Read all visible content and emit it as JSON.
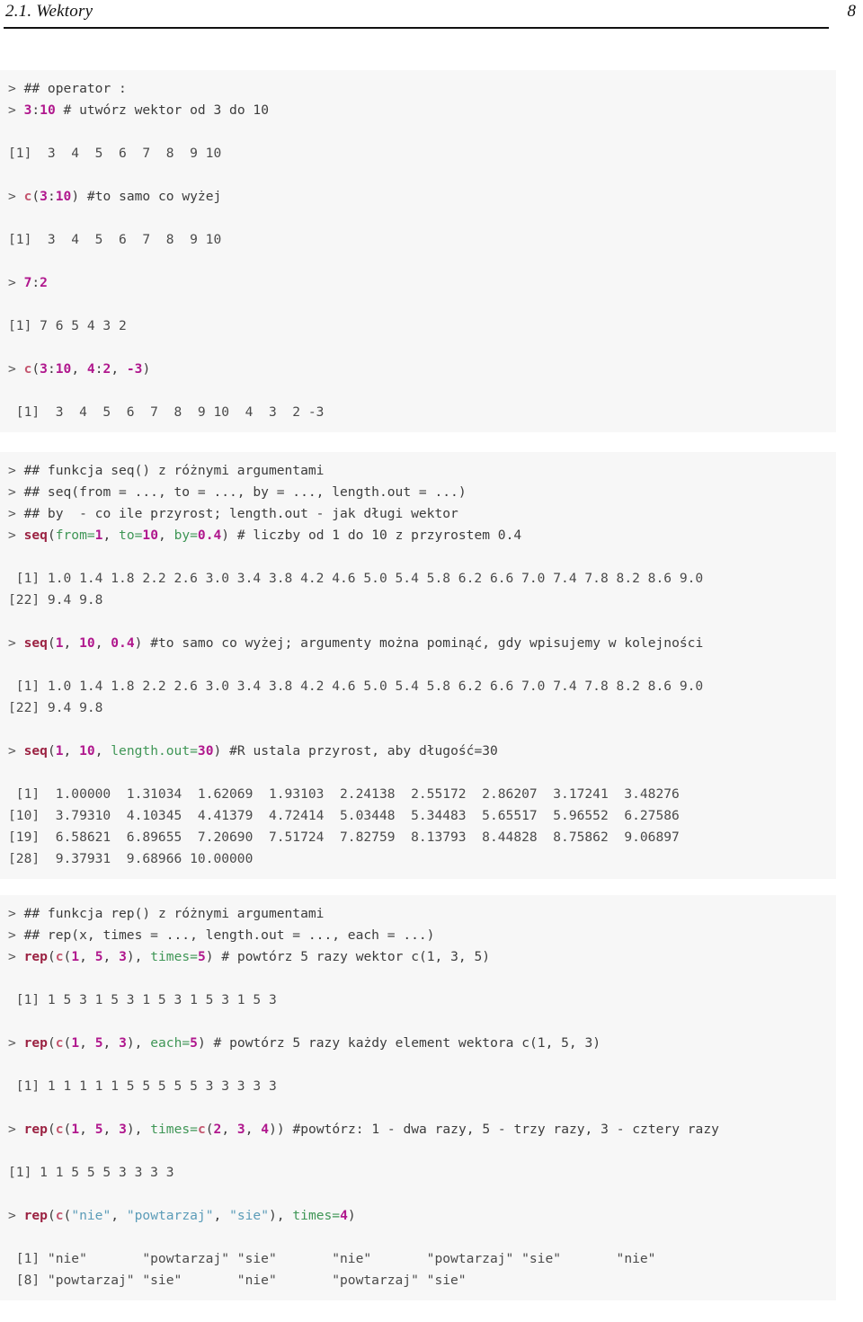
{
  "header": {
    "section_title": "2.1. Wektory",
    "page_number": "8"
  },
  "colors": {
    "page_background": "#ffffff",
    "code_background": "#f7f7f7",
    "code_text": "#3c3c3c",
    "number_token": "#b0178d",
    "function_token": "#9b2242",
    "function_c_token": "#c4566f",
    "argument_token": "#3f9656",
    "string_token": "#5b9cb8",
    "comment_token": "#b9b2bd",
    "output_text": "#4a4a4a",
    "rule_color": "#111111"
  },
  "blocks": [
    {
      "id": "block-operator-colon",
      "lines": [
        {
          "id": "l1",
          "kind": "input",
          "prompt": "> ",
          "segments": [
            {
              "t": "comment",
              "v": "## operator :"
            }
          ]
        },
        {
          "id": "l2",
          "kind": "input",
          "prompt": "> ",
          "segments": [
            {
              "t": "num",
              "v": "3"
            },
            {
              "t": "op",
              "v": ":"
            },
            {
              "t": "num",
              "v": "10"
            },
            {
              "t": "comment",
              "v": " # utwórz wektor od 3 do 10"
            }
          ]
        },
        {
          "id": "l3",
          "kind": "blank",
          "text": " "
        },
        {
          "id": "l4",
          "kind": "output",
          "text": "[1]  3  4  5  6  7  8  9 10"
        },
        {
          "id": "l5",
          "kind": "blank",
          "text": " "
        },
        {
          "id": "l6",
          "kind": "input",
          "prompt": "> ",
          "segments": [
            {
              "t": "fnc",
              "v": "c"
            },
            {
              "t": "op",
              "v": "("
            },
            {
              "t": "num",
              "v": "3"
            },
            {
              "t": "op",
              "v": ":"
            },
            {
              "t": "num",
              "v": "10"
            },
            {
              "t": "op",
              "v": ")"
            },
            {
              "t": "comment",
              "v": " #to samo co wyżej"
            }
          ]
        },
        {
          "id": "l7",
          "kind": "blank",
          "text": " "
        },
        {
          "id": "l8",
          "kind": "output",
          "text": "[1]  3  4  5  6  7  8  9 10"
        },
        {
          "id": "l9",
          "kind": "blank",
          "text": " "
        },
        {
          "id": "l10",
          "kind": "input",
          "prompt": "> ",
          "segments": [
            {
              "t": "num",
              "v": "7"
            },
            {
              "t": "op",
              "v": ":"
            },
            {
              "t": "num",
              "v": "2"
            }
          ]
        },
        {
          "id": "l11",
          "kind": "blank",
          "text": " "
        },
        {
          "id": "l12",
          "kind": "output",
          "text": "[1] 7 6 5 4 3 2"
        },
        {
          "id": "l13",
          "kind": "blank",
          "text": " "
        },
        {
          "id": "l14",
          "kind": "input",
          "prompt": "> ",
          "segments": [
            {
              "t": "fnc",
              "v": "c"
            },
            {
              "t": "op",
              "v": "("
            },
            {
              "t": "num",
              "v": "3"
            },
            {
              "t": "op",
              "v": ":"
            },
            {
              "t": "num",
              "v": "10"
            },
            {
              "t": "op",
              "v": ", "
            },
            {
              "t": "num",
              "v": "4"
            },
            {
              "t": "op",
              "v": ":"
            },
            {
              "t": "num",
              "v": "2"
            },
            {
              "t": "op",
              "v": ", "
            },
            {
              "t": "num",
              "v": "-3"
            },
            {
              "t": "op",
              "v": ")"
            }
          ]
        },
        {
          "id": "l15",
          "kind": "blank",
          "text": " "
        },
        {
          "id": "l16",
          "kind": "output",
          "text": " [1]  3  4  5  6  7  8  9 10  4  3  2 -3"
        }
      ]
    },
    {
      "id": "block-seq",
      "lines": [
        {
          "id": "s1",
          "kind": "input",
          "prompt": "> ",
          "segments": [
            {
              "t": "comment",
              "v": "## funkcja seq() z różnymi argumentami"
            }
          ]
        },
        {
          "id": "s2",
          "kind": "input",
          "prompt": "> ",
          "segments": [
            {
              "t": "comment",
              "v": "## seq(from = ..., to = ..., by = ..., length.out = ...)"
            }
          ]
        },
        {
          "id": "s3",
          "kind": "input",
          "prompt": "> ",
          "segments": [
            {
              "t": "comment",
              "v": "## by  - co ile przyrost; length.out - jak długi wektor"
            }
          ]
        },
        {
          "id": "s4",
          "kind": "input",
          "prompt": "> ",
          "segments": [
            {
              "t": "fn",
              "v": "seq"
            },
            {
              "t": "op",
              "v": "("
            },
            {
              "t": "arg",
              "v": "from="
            },
            {
              "t": "num",
              "v": "1"
            },
            {
              "t": "op",
              "v": ", "
            },
            {
              "t": "arg",
              "v": "to="
            },
            {
              "t": "num",
              "v": "10"
            },
            {
              "t": "op",
              "v": ", "
            },
            {
              "t": "arg",
              "v": "by="
            },
            {
              "t": "num",
              "v": "0.4"
            },
            {
              "t": "op",
              "v": ")"
            },
            {
              "t": "comment",
              "v": " # liczby od 1 do 10 z przyrostem 0.4"
            }
          ]
        },
        {
          "id": "s5",
          "kind": "blank",
          "text": " "
        },
        {
          "id": "s6",
          "kind": "output",
          "text": " [1] 1.0 1.4 1.8 2.2 2.6 3.0 3.4 3.8 4.2 4.6 5.0 5.4 5.8 6.2 6.6 7.0 7.4 7.8 8.2 8.6 9.0"
        },
        {
          "id": "s7",
          "kind": "output",
          "text": "[22] 9.4 9.8"
        },
        {
          "id": "s8",
          "kind": "blank",
          "text": " "
        },
        {
          "id": "s9",
          "kind": "input",
          "prompt": "> ",
          "segments": [
            {
              "t": "fn",
              "v": "seq"
            },
            {
              "t": "op",
              "v": "("
            },
            {
              "t": "num",
              "v": "1"
            },
            {
              "t": "op",
              "v": ", "
            },
            {
              "t": "num",
              "v": "10"
            },
            {
              "t": "op",
              "v": ", "
            },
            {
              "t": "num",
              "v": "0.4"
            },
            {
              "t": "op",
              "v": ")"
            },
            {
              "t": "comment",
              "v": " #to samo co wyżej; argumenty można pominąć, gdy wpisujemy w kolejności"
            }
          ]
        },
        {
          "id": "s10",
          "kind": "blank",
          "text": " "
        },
        {
          "id": "s11",
          "kind": "output",
          "text": " [1] 1.0 1.4 1.8 2.2 2.6 3.0 3.4 3.8 4.2 4.6 5.0 5.4 5.8 6.2 6.6 7.0 7.4 7.8 8.2 8.6 9.0"
        },
        {
          "id": "s12",
          "kind": "output",
          "text": "[22] 9.4 9.8"
        },
        {
          "id": "s13",
          "kind": "blank",
          "text": " "
        },
        {
          "id": "s14",
          "kind": "input",
          "prompt": "> ",
          "segments": [
            {
              "t": "fn",
              "v": "seq"
            },
            {
              "t": "op",
              "v": "("
            },
            {
              "t": "num",
              "v": "1"
            },
            {
              "t": "op",
              "v": ", "
            },
            {
              "t": "num",
              "v": "10"
            },
            {
              "t": "op",
              "v": ", "
            },
            {
              "t": "arg",
              "v": "length.out="
            },
            {
              "t": "num",
              "v": "30"
            },
            {
              "t": "op",
              "v": ")"
            },
            {
              "t": "comment",
              "v": " #R ustala przyrost, aby długość=30"
            }
          ]
        },
        {
          "id": "s15",
          "kind": "blank",
          "text": " "
        },
        {
          "id": "s16",
          "kind": "output",
          "text": " [1]  1.00000  1.31034  1.62069  1.93103  2.24138  2.55172  2.86207  3.17241  3.48276"
        },
        {
          "id": "s17",
          "kind": "output",
          "text": "[10]  3.79310  4.10345  4.41379  4.72414  5.03448  5.34483  5.65517  5.96552  6.27586"
        },
        {
          "id": "s18",
          "kind": "output",
          "text": "[19]  6.58621  6.89655  7.20690  7.51724  7.82759  8.13793  8.44828  8.75862  9.06897"
        },
        {
          "id": "s19",
          "kind": "output",
          "text": "[28]  9.37931  9.68966 10.00000"
        }
      ]
    },
    {
      "id": "block-rep",
      "lines": [
        {
          "id": "r1",
          "kind": "input",
          "prompt": "> ",
          "segments": [
            {
              "t": "comment",
              "v": "## funkcja rep() z różnymi argumentami"
            }
          ]
        },
        {
          "id": "r2",
          "kind": "input",
          "prompt": "> ",
          "segments": [
            {
              "t": "comment",
              "v": "## rep(x, times = ..., length.out = ..., each = ...)"
            }
          ]
        },
        {
          "id": "r3",
          "kind": "input",
          "prompt": "> ",
          "segments": [
            {
              "t": "fn",
              "v": "rep"
            },
            {
              "t": "op",
              "v": "("
            },
            {
              "t": "fnc",
              "v": "c"
            },
            {
              "t": "op",
              "v": "("
            },
            {
              "t": "num",
              "v": "1"
            },
            {
              "t": "op",
              "v": ", "
            },
            {
              "t": "num",
              "v": "5"
            },
            {
              "t": "op",
              "v": ", "
            },
            {
              "t": "num",
              "v": "3"
            },
            {
              "t": "op",
              "v": "), "
            },
            {
              "t": "arg",
              "v": "times="
            },
            {
              "t": "num",
              "v": "5"
            },
            {
              "t": "op",
              "v": ")"
            },
            {
              "t": "comment",
              "v": " # powtórz 5 razy wektor c(1, 3, 5)"
            }
          ]
        },
        {
          "id": "r4",
          "kind": "blank",
          "text": " "
        },
        {
          "id": "r5",
          "kind": "output",
          "text": " [1] 1 5 3 1 5 3 1 5 3 1 5 3 1 5 3"
        },
        {
          "id": "r6",
          "kind": "blank",
          "text": " "
        },
        {
          "id": "r7",
          "kind": "input",
          "prompt": "> ",
          "segments": [
            {
              "t": "fn",
              "v": "rep"
            },
            {
              "t": "op",
              "v": "("
            },
            {
              "t": "fnc",
              "v": "c"
            },
            {
              "t": "op",
              "v": "("
            },
            {
              "t": "num",
              "v": "1"
            },
            {
              "t": "op",
              "v": ", "
            },
            {
              "t": "num",
              "v": "5"
            },
            {
              "t": "op",
              "v": ", "
            },
            {
              "t": "num",
              "v": "3"
            },
            {
              "t": "op",
              "v": "), "
            },
            {
              "t": "arg",
              "v": "each="
            },
            {
              "t": "num",
              "v": "5"
            },
            {
              "t": "op",
              "v": ")"
            },
            {
              "t": "comment",
              "v": " # powtórz 5 razy każdy element wektora c(1, 5, 3)"
            }
          ]
        },
        {
          "id": "r8",
          "kind": "blank",
          "text": " "
        },
        {
          "id": "r9",
          "kind": "output",
          "text": " [1] 1 1 1 1 1 5 5 5 5 5 3 3 3 3 3"
        },
        {
          "id": "r10",
          "kind": "blank",
          "text": " "
        },
        {
          "id": "r11",
          "kind": "input",
          "prompt": "> ",
          "segments": [
            {
              "t": "fn",
              "v": "rep"
            },
            {
              "t": "op",
              "v": "("
            },
            {
              "t": "fnc",
              "v": "c"
            },
            {
              "t": "op",
              "v": "("
            },
            {
              "t": "num",
              "v": "1"
            },
            {
              "t": "op",
              "v": ", "
            },
            {
              "t": "num",
              "v": "5"
            },
            {
              "t": "op",
              "v": ", "
            },
            {
              "t": "num",
              "v": "3"
            },
            {
              "t": "op",
              "v": "), "
            },
            {
              "t": "arg",
              "v": "times="
            },
            {
              "t": "fnc",
              "v": "c"
            },
            {
              "t": "op",
              "v": "("
            },
            {
              "t": "num",
              "v": "2"
            },
            {
              "t": "op",
              "v": ", "
            },
            {
              "t": "num",
              "v": "3"
            },
            {
              "t": "op",
              "v": ", "
            },
            {
              "t": "num",
              "v": "4"
            },
            {
              "t": "op",
              "v": "))"
            },
            {
              "t": "comment",
              "v": " #powtórz: 1 - dwa razy, 5 - trzy razy, 3 - cztery razy"
            }
          ]
        },
        {
          "id": "r12",
          "kind": "blank",
          "text": " "
        },
        {
          "id": "r13",
          "kind": "output",
          "text": "[1] 1 1 5 5 5 3 3 3 3"
        },
        {
          "id": "r14",
          "kind": "blank",
          "text": " "
        },
        {
          "id": "r15",
          "kind": "input",
          "prompt": "> ",
          "segments": [
            {
              "t": "fn",
              "v": "rep"
            },
            {
              "t": "op",
              "v": "("
            },
            {
              "t": "fnc",
              "v": "c"
            },
            {
              "t": "op",
              "v": "("
            },
            {
              "t": "str",
              "v": "\"nie\""
            },
            {
              "t": "op",
              "v": ", "
            },
            {
              "t": "str",
              "v": "\"powtarzaj\""
            },
            {
              "t": "op",
              "v": ", "
            },
            {
              "t": "str",
              "v": "\"sie\""
            },
            {
              "t": "op",
              "v": "), "
            },
            {
              "t": "arg",
              "v": "times="
            },
            {
              "t": "num",
              "v": "4"
            },
            {
              "t": "op",
              "v": ")"
            }
          ]
        },
        {
          "id": "r16",
          "kind": "blank",
          "text": " "
        },
        {
          "id": "r17",
          "kind": "output",
          "text": " [1] \"nie\"       \"powtarzaj\" \"sie\"       \"nie\"       \"powtarzaj\" \"sie\"       \"nie\""
        },
        {
          "id": "r18",
          "kind": "output",
          "text": " [8] \"powtarzaj\" \"sie\"       \"nie\"       \"powtarzaj\" \"sie\""
        }
      ]
    }
  ]
}
